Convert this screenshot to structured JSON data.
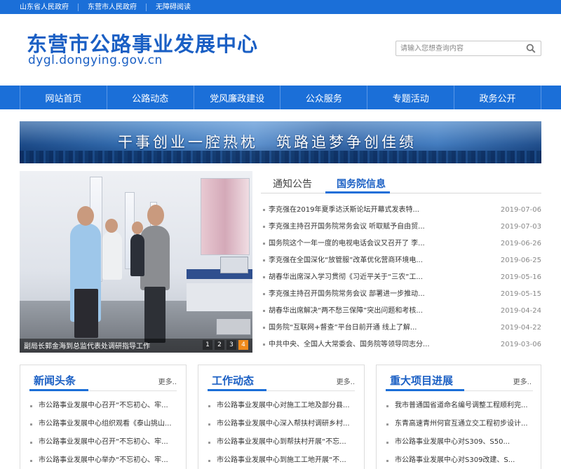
{
  "topbar": {
    "links": [
      "山东省人民政府",
      "东营市人民政府",
      "无障碍阅读"
    ]
  },
  "header": {
    "title": "东营市公路事业发展中心",
    "domain": "dygl.dongying.gov.cn",
    "search_placeholder": "请输入您想查询内容",
    "search_icon": "search-icon"
  },
  "nav": {
    "items": [
      "网站首页",
      "公路动态",
      "党风廉政建设",
      "公众服务",
      "专题活动",
      "政务公开"
    ]
  },
  "banner": {
    "slogan_left": "干事创业一腔热枕",
    "slogan_right": "筑路追梦争创佳绩"
  },
  "slideshow": {
    "caption": "副局长郭金海到总监代表处调研指导工作",
    "pages": [
      "1",
      "2",
      "3",
      "4"
    ],
    "active_page": 4
  },
  "news_tabs": {
    "tabs": [
      "通知公告",
      "国务院信息"
    ],
    "active_tab": "国务院信息",
    "items": [
      {
        "title": "李克强在2019年夏季达沃斯论坛开幕式发表特...",
        "date": "2019-07-06"
      },
      {
        "title": "李克强主持召开国务院常务会议 听取赋予自由贸...",
        "date": "2019-07-03"
      },
      {
        "title": "国务院这个一年一度的电视电话会议又召开了 李...",
        "date": "2019-06-26"
      },
      {
        "title": "李克强在全国深化“放管服”改革优化营商环境电...",
        "date": "2019-06-25"
      },
      {
        "title": "胡春华出席深入学习贯彻《习近平关于“三农”工...",
        "date": "2019-05-16"
      },
      {
        "title": "李克强主持召开国务院常务会议 部署进一步推动...",
        "date": "2019-05-15"
      },
      {
        "title": "胡春华出席解决“两不愁三保障”突出问题和考核...",
        "date": "2019-04-24"
      },
      {
        "title": "国务院“互联网+督查”平台日前开通 线上了解...",
        "date": "2019-04-22"
      },
      {
        "title": "中共中央、全国人大常委会、国务院等领导同志分...",
        "date": "2019-03-06"
      }
    ]
  },
  "columns": [
    {
      "title": "新闻头条",
      "more": "更多..",
      "items": [
        "市公路事业发展中心召开“不忘初心、牢...",
        "市公路事业发展中心组织观看《泰山挑山...",
        "市公路事业发展中心召开“不忘初心、牢...",
        "市公路事业发展中心举办“不忘初心、牢..."
      ]
    },
    {
      "title": "工作动态",
      "more": "更多..",
      "items": [
        "市公路事业发展中心对施工工地及部分县...",
        "市公路事业发展中心深入帮扶村调研乡村...",
        "市公路事业发展中心到帮扶村开展“不忘...",
        "市公路事业发展中心到施工工地开展“不..."
      ]
    },
    {
      "title": "重大项目进展",
      "more": "更多..",
      "items": [
        "我市普通国省道命名编号调整工程顺利完...",
        "东青高速青州何官互通立交工程初步设计...",
        "市公路事业发展中心对S309、S50...",
        "市公路事业发展中心对S309改建、S..."
      ]
    }
  ],
  "colors": {
    "brand_blue": "#1b6fd8",
    "title_blue": "#1a5fc4",
    "active_page_orange": "#f08a1c"
  }
}
